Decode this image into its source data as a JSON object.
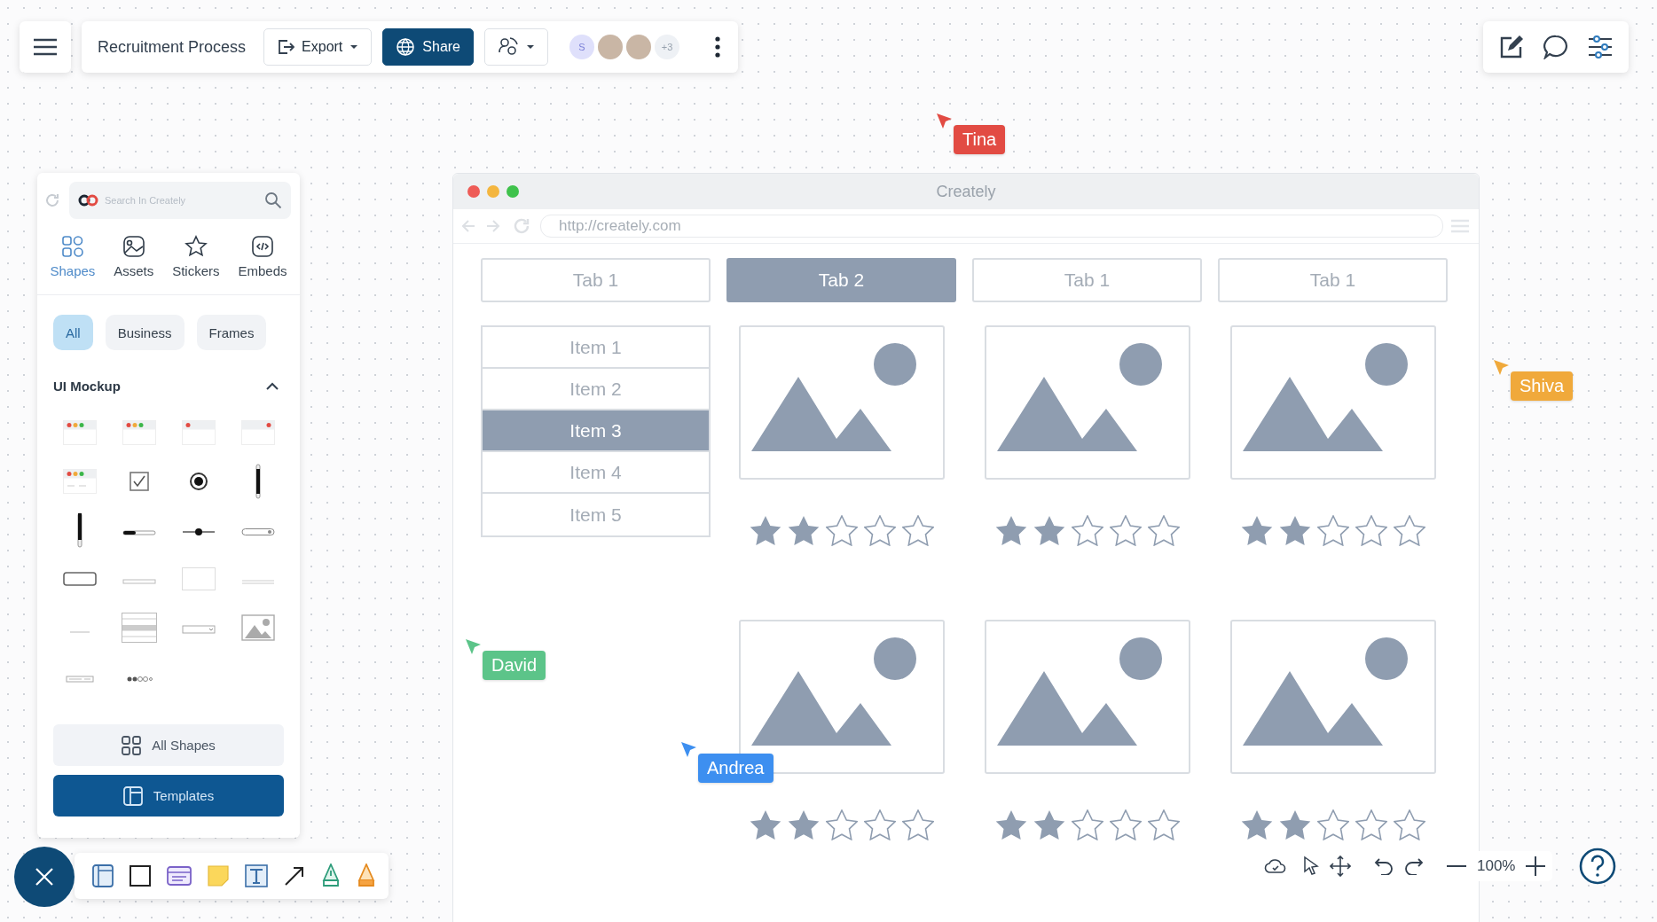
{
  "toolbar": {
    "title": "Recruitment Process",
    "export": "Export",
    "share": "Share",
    "avatars": [
      {
        "kind": "initial",
        "text": "S"
      },
      {
        "kind": "photo"
      },
      {
        "kind": "photo"
      },
      {
        "kind": "count",
        "text": "+3"
      }
    ]
  },
  "panel": {
    "search_placeholder": "Search In Creately",
    "categories": [
      {
        "label": "Shapes",
        "selected": true
      },
      {
        "label": "Assets",
        "selected": false
      },
      {
        "label": "Stickers",
        "selected": false
      },
      {
        "label": "Embeds",
        "selected": false
      }
    ],
    "filters": [
      {
        "label": "All",
        "selected": true
      },
      {
        "label": "Business",
        "selected": false
      },
      {
        "label": "Frames",
        "selected": false
      }
    ],
    "section": {
      "title": "UI Mockup",
      "expanded": true
    },
    "shapes": [
      {
        "kind": "window3"
      },
      {
        "kind": "window3"
      },
      {
        "kind": "window-left"
      },
      {
        "kind": "window-right"
      },
      {
        "kind": "window-form"
      },
      {
        "kind": "checkbox"
      },
      {
        "kind": "radio"
      },
      {
        "kind": "vscroll"
      },
      {
        "kind": "vslider"
      },
      {
        "kind": "progress"
      },
      {
        "kind": "hslider"
      },
      {
        "kind": "spinner"
      },
      {
        "kind": "button"
      },
      {
        "kind": "textline"
      },
      {
        "kind": "panel"
      },
      {
        "kind": "breadcrumb"
      },
      {
        "kind": "dash"
      },
      {
        "kind": "listbox"
      },
      {
        "kind": "dropdown"
      },
      {
        "kind": "image"
      },
      {
        "kind": "tags"
      },
      {
        "kind": "rating"
      }
    ],
    "all_shapes": "All Shapes",
    "templates": "Templates"
  },
  "mockup": {
    "title": "Creately",
    "url": "http://creately.com",
    "tabs": [
      {
        "label": "Tab 1",
        "selected": false
      },
      {
        "label": "Tab 2",
        "selected": true
      },
      {
        "label": "Tab 1",
        "selected": false
      },
      {
        "label": "Tab 1",
        "selected": false
      }
    ],
    "list": [
      {
        "label": "Item 1",
        "selected": false
      },
      {
        "label": "Item 2",
        "selected": false
      },
      {
        "label": "Item 3",
        "selected": true
      },
      {
        "label": "Item 4",
        "selected": false
      },
      {
        "label": "Item 5",
        "selected": false
      }
    ],
    "cards": [
      {
        "stars": 2
      },
      {
        "stars": 2
      },
      {
        "stars": 2
      },
      {
        "stars": 2
      },
      {
        "stars": 2
      },
      {
        "stars": 2
      }
    ]
  },
  "cursors": [
    {
      "name": "Tina",
      "color": "#e24b43"
    },
    {
      "name": "Shiva",
      "color": "#f0a93b"
    },
    {
      "name": "David",
      "color": "#5cc489"
    },
    {
      "name": "Andrea",
      "color": "#3d8ff0"
    }
  ],
  "zoom": "100%"
}
